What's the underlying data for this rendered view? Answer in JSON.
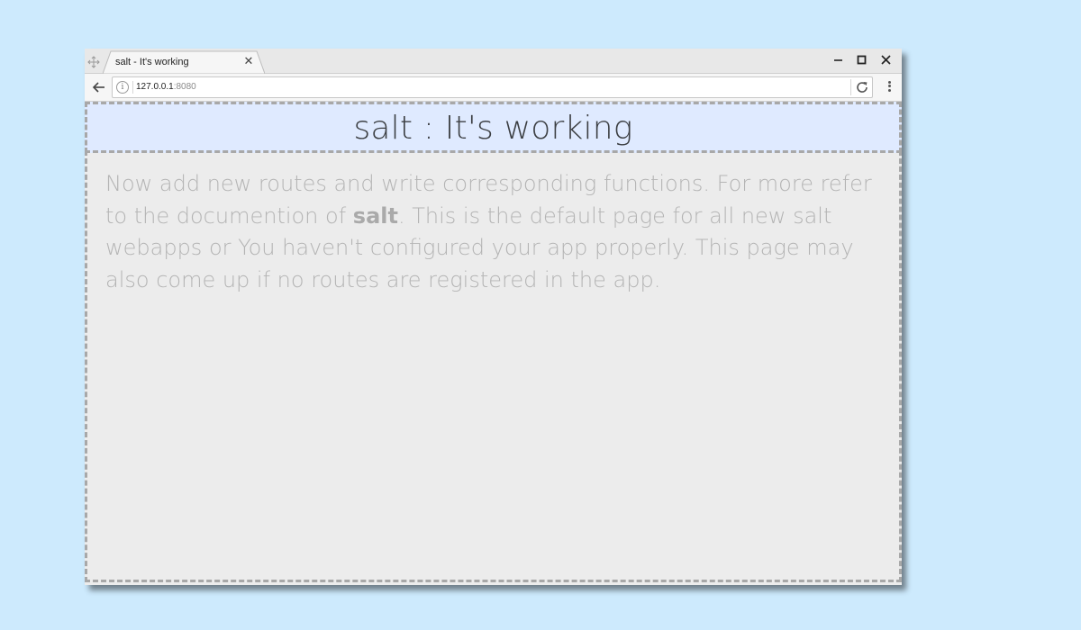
{
  "browser": {
    "tab": {
      "title": "salt - It's working",
      "close_glyph": "✕"
    },
    "window_controls": {
      "minimize_glyph": "–",
      "maximize_glyph": "□",
      "close_glyph": "✕"
    },
    "address_bar": {
      "host": "127.0.0.1",
      "port": ":8080",
      "info_glyph": "i"
    },
    "icons": {
      "back": "back-arrow-icon",
      "reload": "reload-icon",
      "menu": "three-dot-menu-icon",
      "drag": "move-icon"
    }
  },
  "page": {
    "heading": "salt : It's working",
    "paragraph_before": "Now add new routes and write corresponding functions. For more refer to the documention of ",
    "paragraph_bold": "salt",
    "paragraph_after": ". This is the default page for all new salt webapps or You haven't configured your app properly. This page may also come up if no routes are registered in the app."
  },
  "colors": {
    "desktop_bg": "#cdeafd",
    "header_bg": "#dfeaff",
    "page_bg": "#ececec",
    "dashed_border": "#a8a8a8",
    "heading_text": "#3c3f43",
    "body_text": "#b4b4b4"
  }
}
